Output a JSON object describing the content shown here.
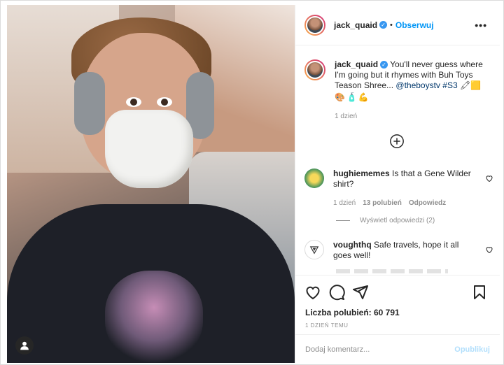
{
  "post": {
    "username": "jack_quaid",
    "follow_label": "Obserwuj",
    "dot": "•",
    "more_label": "•••"
  },
  "caption": {
    "username": "jack_quaid",
    "text": " You'll never guess where I'm going but it rhymes with Buh Toys Teason Shree... ",
    "mention": "@theboystv",
    "hashtag": "#S3",
    "emoji_end": "🖍🟨",
    "emoji_line": "🎨🧴💪",
    "time": "1 dzień"
  },
  "comments": [
    {
      "username": "hughiememes",
      "text": " Is that a Gene Wilder shirt?",
      "time": "1 dzień",
      "likes": "13 polubień",
      "reply": "Odpowiedz"
    },
    {
      "username": "voughthq",
      "text": " Safe travels, hope it all goes well!"
    }
  ],
  "view_replies": "Wyświetl odpowiedzi (2)",
  "likes_label": "Liczba polubień: 60 791",
  "posted_ago": "1 DZIEŃ TEMU",
  "comment_input": {
    "placeholder": "Dodaj komentarz...",
    "publish_label": "Opublikuj"
  },
  "colors": {
    "link": "#0095f6",
    "publish_disabled": "#b2dffc",
    "verified": "#3897f0"
  },
  "icons": [
    "heart-icon",
    "comment-icon",
    "share-icon",
    "save-icon",
    "add-circle-icon",
    "user-tag-icon",
    "verified-icon"
  ]
}
